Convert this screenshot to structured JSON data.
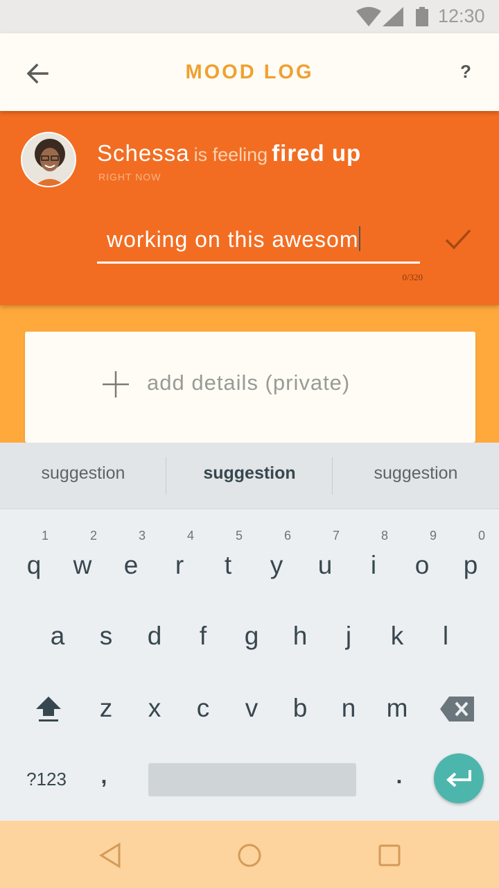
{
  "status_bar": {
    "time": "12:30"
  },
  "app_bar": {
    "title": "MOOD LOG",
    "help_label": "?"
  },
  "mood": {
    "name": "Schessa",
    "connector": "is feeling",
    "feeling": "fired up",
    "when": "RIGHT NOW",
    "input_value": "working on this awesom",
    "counter": "0/320"
  },
  "details": {
    "label": "add details (private)"
  },
  "keyboard": {
    "suggestions": [
      "suggestion",
      "suggestion",
      "suggestion"
    ],
    "row1": [
      {
        "key": "q",
        "hint": "1"
      },
      {
        "key": "w",
        "hint": "2"
      },
      {
        "key": "e",
        "hint": "3"
      },
      {
        "key": "r",
        "hint": "4"
      },
      {
        "key": "t",
        "hint": "5"
      },
      {
        "key": "y",
        "hint": "6"
      },
      {
        "key": "u",
        "hint": "7"
      },
      {
        "key": "i",
        "hint": "8"
      },
      {
        "key": "o",
        "hint": "9"
      },
      {
        "key": "p",
        "hint": "0"
      }
    ],
    "row2": [
      "a",
      "s",
      "d",
      "f",
      "g",
      "h",
      "j",
      "k",
      "l"
    ],
    "row3": [
      "z",
      "x",
      "c",
      "v",
      "b",
      "n",
      "m"
    ],
    "symbols_label": "?123",
    "comma": ",",
    "period": "."
  },
  "colors": {
    "accent_orange": "#f26d22",
    "background_orange": "#ffa93c",
    "title_gold": "#f0a030",
    "enter_teal": "#4db6ac"
  },
  "icons": {
    "back": "arrow-left-icon",
    "confirm": "checkmark-icon",
    "add": "plus-icon",
    "shift": "shift-icon",
    "backspace": "backspace-icon",
    "enter": "enter-icon",
    "nav_back": "triangle-back-icon",
    "nav_home": "circle-home-icon",
    "nav_recents": "square-recents-icon"
  }
}
